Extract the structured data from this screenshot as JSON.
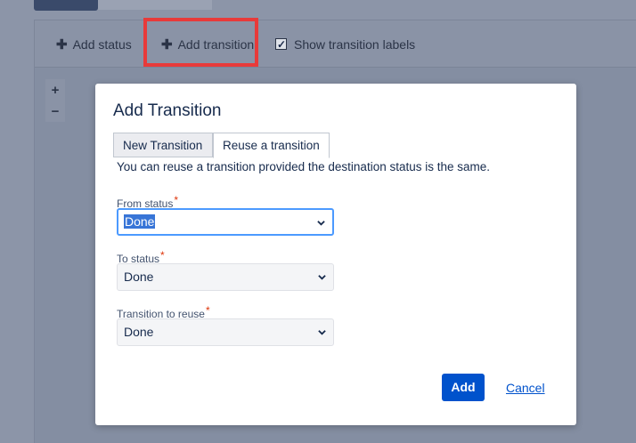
{
  "toolbar": {
    "add_status_label": "Add status",
    "add_transition_label": "Add transition",
    "show_labels_label": "Show transition labels",
    "show_labels_checked": true
  },
  "zoom": {
    "in_label": "+",
    "out_label": "−"
  },
  "modal": {
    "title": "Add Transition",
    "tabs": [
      {
        "label": "New Transition",
        "active": false
      },
      {
        "label": "Reuse a transition",
        "active": true
      }
    ],
    "description": "You can reuse a transition provided the destination status is the same.",
    "fields": {
      "from_status": {
        "label": "From status",
        "value": "Done",
        "required": true
      },
      "to_status": {
        "label": "To status",
        "value": "Done",
        "required": true
      },
      "transition_to_reuse": {
        "label": "Transition to reuse",
        "value": "Done",
        "required": true
      }
    },
    "required_marker": "*",
    "add_button": "Add",
    "cancel_link": "Cancel"
  },
  "colors": {
    "primary": "#0052cc",
    "highlight": "#e83a3a",
    "required": "#de350b",
    "focus": "#4c9aff"
  },
  "icons": {
    "plus": "plus-icon",
    "checkbox": "checkbox-checked-icon",
    "dropdown": "chevron-down-icon"
  }
}
